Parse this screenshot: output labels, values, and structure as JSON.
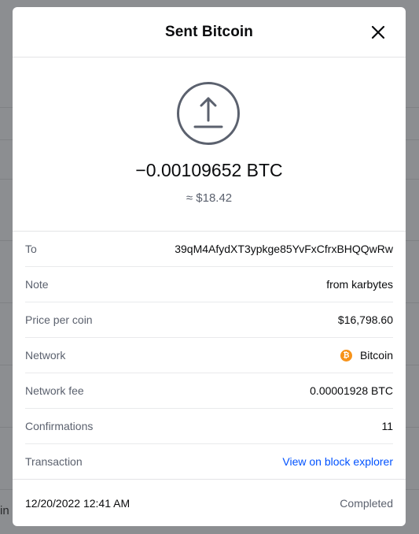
{
  "background": {
    "edge_text": "in"
  },
  "modal": {
    "title": "Sent Bitcoin",
    "close_icon": "close-icon",
    "send_icon": "upload-arrow-icon",
    "amount": "−0.00109652 BTC",
    "fiat_value": "≈ $18.42"
  },
  "details": [
    {
      "label": "To",
      "value": "39qM4AfydXT3ypkge85YvFxCfrxBHQQwRw"
    },
    {
      "label": "Note",
      "value": "from karbytes"
    },
    {
      "label": "Price per coin",
      "value": "$16,798.60"
    },
    {
      "label": "Network",
      "value": "Bitcoin",
      "icon": "bitcoin-icon",
      "icon_glyph": "₿"
    },
    {
      "label": "Network fee",
      "value": "0.00001928 BTC"
    },
    {
      "label": "Confirmations",
      "value": "11"
    },
    {
      "label": "Transaction",
      "value": "View on block explorer"
    }
  ],
  "footer": {
    "date": "12/20/2022 12:41 AM",
    "status": "Completed"
  },
  "colors": {
    "accent_link": "#0052ff",
    "bitcoin_orange": "#f7931a",
    "overlay": "#8c8e91"
  }
}
